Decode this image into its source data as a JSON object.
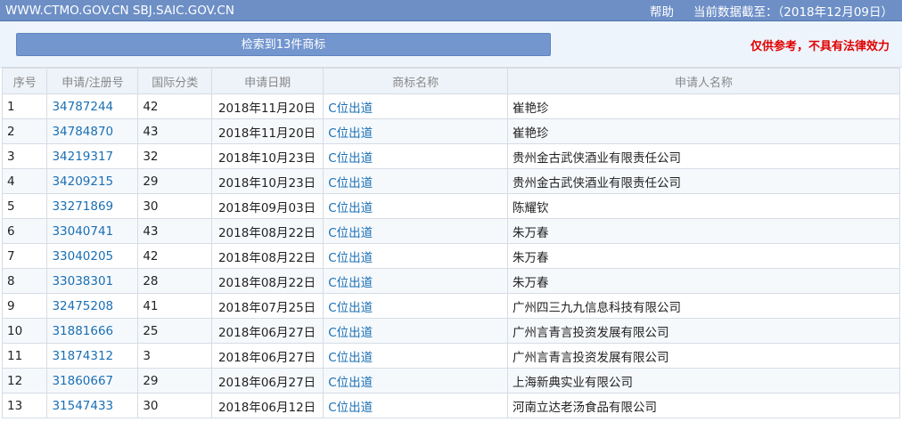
{
  "header": {
    "sites": "WWW.CTMO.GOV.CN  SBJ.SAIC.GOV.CN",
    "help": "帮助",
    "data_date": "当前数据截至：（2018年12月09日）"
  },
  "summary": {
    "result_text": "检索到13件商标",
    "notice": "仅供参考，不具有法律效力"
  },
  "table": {
    "columns": [
      "序号",
      "申请/注册号",
      "国际分类",
      "申请日期",
      "商标名称",
      "申请人名称"
    ],
    "rows": [
      {
        "no": "1",
        "reg": "34787244",
        "cls": "42",
        "date": "2018年11月20日",
        "mark": "C位出道",
        "applicant": "崔艳珍"
      },
      {
        "no": "2",
        "reg": "34784870",
        "cls": "43",
        "date": "2018年11月20日",
        "mark": "C位出道",
        "applicant": "崔艳珍"
      },
      {
        "no": "3",
        "reg": "34219317",
        "cls": "32",
        "date": "2018年10月23日",
        "mark": "C位出道",
        "applicant": "贵州金古武侠酒业有限责任公司"
      },
      {
        "no": "4",
        "reg": "34209215",
        "cls": "29",
        "date": "2018年10月23日",
        "mark": "C位出道",
        "applicant": "贵州金古武侠酒业有限责任公司"
      },
      {
        "no": "5",
        "reg": "33271869",
        "cls": "30",
        "date": "2018年09月03日",
        "mark": "C位出道",
        "applicant": "陈耀钦"
      },
      {
        "no": "6",
        "reg": "33040741",
        "cls": "43",
        "date": "2018年08月22日",
        "mark": "C位出道",
        "applicant": "朱万春"
      },
      {
        "no": "7",
        "reg": "33040205",
        "cls": "42",
        "date": "2018年08月22日",
        "mark": "C位出道",
        "applicant": "朱万春"
      },
      {
        "no": "8",
        "reg": "33038301",
        "cls": "28",
        "date": "2018年08月22日",
        "mark": "C位出道",
        "applicant": "朱万春"
      },
      {
        "no": "9",
        "reg": "32475208",
        "cls": "41",
        "date": "2018年07月25日",
        "mark": "C位出道",
        "applicant": "广州四三九九信息科技有限公司"
      },
      {
        "no": "10",
        "reg": "31881666",
        "cls": "25",
        "date": "2018年06月27日",
        "mark": "C位出道",
        "applicant": "广州言青言投资发展有限公司"
      },
      {
        "no": "11",
        "reg": "31874312",
        "cls": "3",
        "date": "2018年06月27日",
        "mark": "C位出道",
        "applicant": "广州言青言投资发展有限公司"
      },
      {
        "no": "12",
        "reg": "31860667",
        "cls": "29",
        "date": "2018年06月27日",
        "mark": "C位出道",
        "applicant": "上海新典实业有限公司"
      },
      {
        "no": "13",
        "reg": "31547433",
        "cls": "30",
        "date": "2018年06月12日",
        "mark": "C位出道",
        "applicant": "河南立达老汤食品有限公司"
      }
    ]
  }
}
